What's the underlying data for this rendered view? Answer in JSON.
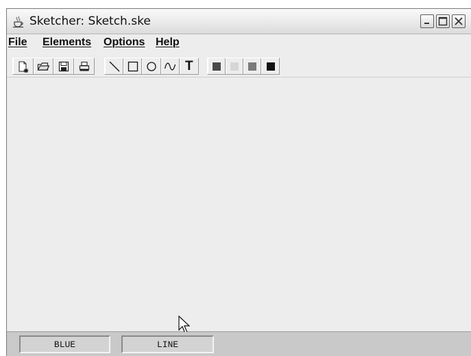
{
  "window": {
    "title": "Sketcher: Sketch.ske",
    "app_icon": "java-cup-icon",
    "controls": [
      "minimize-icon",
      "maximize-icon",
      "close-icon"
    ]
  },
  "menubar": {
    "items": [
      {
        "label": "File"
      },
      {
        "label": "Elements"
      },
      {
        "label": "Options"
      },
      {
        "label": "Help"
      }
    ]
  },
  "toolbar": {
    "file_tools": [
      "new-file-icon",
      "open-file-icon",
      "save-icon",
      "print-icon"
    ],
    "element_tools": [
      "line-icon",
      "rectangle-icon",
      "circle-icon",
      "curve-icon",
      "text-icon"
    ],
    "text_tool_glyph": "T",
    "color_tools": [
      {
        "name": "red-color",
        "swatch": "#4a4a4a"
      },
      {
        "name": "yellow-color",
        "swatch": "#d6d6d6"
      },
      {
        "name": "green-color",
        "swatch": "#7a7a7a"
      },
      {
        "name": "blue-color",
        "swatch": "#111111"
      }
    ]
  },
  "statusbar": {
    "color": "BLUE",
    "element_type": "LINE"
  }
}
